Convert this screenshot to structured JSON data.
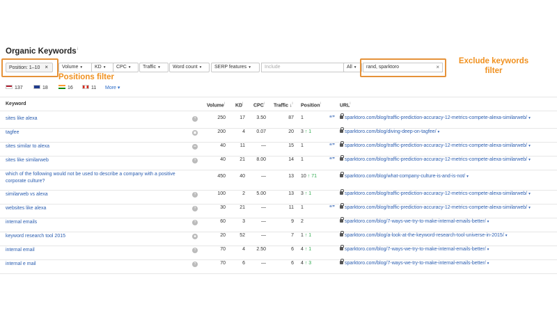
{
  "title": "Organic Keywords",
  "title_info": "i",
  "filters": {
    "position": "Position: 1–10",
    "position_clear": "×",
    "volume": "Volume",
    "kd": "KD",
    "cpc": "CPC",
    "traffic": "Traffic",
    "word_count": "Word count",
    "serp_features": "SERP features",
    "include_placeholder": "Include",
    "all": "All",
    "exclude_value": "rand, sparktoro",
    "exclude_clear": "×",
    "caret": "▾"
  },
  "callouts": {
    "positions": "Positions filter",
    "exclude": "Exclude keywords filter"
  },
  "countries": [
    {
      "code": "us",
      "count": "137"
    },
    {
      "code": "uk",
      "count": "18"
    },
    {
      "code": "in",
      "count": "16"
    },
    {
      "code": "ca",
      "count": "11"
    }
  ],
  "more": "More ▾",
  "columns": {
    "keyword": "Keyword",
    "volume": "Volume",
    "kd": "KD",
    "cpc": "CPC",
    "traffic": "Traffic ↓",
    "position": "Position",
    "url": "URL"
  },
  "rows": [
    {
      "keyword": "sites like alexa",
      "volume": "250",
      "kd": "17",
      "cpc": "3.50",
      "traffic": "87",
      "position": "1",
      "change": "",
      "serp": "?",
      "quote": "“”",
      "url": "sparktoro.com/blog/traffic-prediction-accuracy-12-metrics-compete-alexa-similarweb/"
    },
    {
      "keyword": "tagfee",
      "volume": "200",
      "kd": "4",
      "cpc": "0.07",
      "traffic": "20",
      "position": "3",
      "change": "↑ 1",
      "serp": "▣",
      "quote": "",
      "url": "sparktoro.com/blog/diving-deep-on-tagfee/"
    },
    {
      "keyword": "sites similar to alexa",
      "volume": "40",
      "kd": "11",
      "cpc": "—",
      "traffic": "15",
      "position": "1",
      "change": "",
      "serp": "••",
      "quote": "“”",
      "url": "sparktoro.com/blog/traffic-prediction-accuracy-12-metrics-compete-alexa-similarweb/"
    },
    {
      "keyword": "sites like similarweb",
      "volume": "40",
      "kd": "21",
      "cpc": "8.00",
      "traffic": "14",
      "position": "1",
      "change": "",
      "serp": "?",
      "quote": "“”",
      "url": "sparktoro.com/blog/traffic-prediction-accuracy-12-metrics-compete-alexa-similarweb/"
    },
    {
      "keyword": "which of the following would not be used to describe a company with a positive corporate culture?",
      "volume": "450",
      "kd": "40",
      "cpc": "—",
      "traffic": "13",
      "position": "10",
      "change": "↑ 71",
      "serp": "",
      "quote": "",
      "url": "sparktoro.com/blog/what-company-culture-is-and-is-not/"
    },
    {
      "keyword": "similarweb vs alexa",
      "volume": "100",
      "kd": "2",
      "cpc": "5.00",
      "traffic": "13",
      "position": "3",
      "change": "↑ 1",
      "serp": "?",
      "quote": "",
      "url": "sparktoro.com/blog/traffic-prediction-accuracy-12-metrics-compete-alexa-similarweb/"
    },
    {
      "keyword": "websites like alexa",
      "volume": "30",
      "kd": "21",
      "cpc": "—",
      "traffic": "11",
      "position": "1",
      "change": "",
      "serp": "?",
      "quote": "“”",
      "url": "sparktoro.com/blog/traffic-prediction-accuracy-12-metrics-compete-alexa-similarweb/"
    },
    {
      "keyword": "internal emails",
      "volume": "60",
      "kd": "3",
      "cpc": "—",
      "traffic": "9",
      "position": "2",
      "change": "",
      "serp": "?",
      "quote": "",
      "url": "sparktoro.com/blog/7-ways-we-try-to-make-internal-emails-better/"
    },
    {
      "keyword": "keyword research tool 2015",
      "volume": "20",
      "kd": "52",
      "cpc": "—",
      "traffic": "7",
      "position": "1",
      "change": "↑ 1",
      "serp": "■",
      "quote": "",
      "url": "sparktoro.com/blog/a-look-at-the-keyword-research-tool-universe-in-2015/"
    },
    {
      "keyword": "internal email",
      "volume": "70",
      "kd": "4",
      "cpc": "2.50",
      "traffic": "6",
      "position": "4",
      "change": "↑ 1",
      "serp": "?",
      "quote": "",
      "url": "sparktoro.com/blog/7-ways-we-try-to-make-internal-emails-better/"
    },
    {
      "keyword": "internal e mail",
      "volume": "70",
      "kd": "6",
      "cpc": "—",
      "traffic": "6",
      "position": "4",
      "change": "↑ 3",
      "serp": "?",
      "quote": "",
      "url": "sparktoro.com/blog/7-ways-we-try-to-make-internal-emails-better/"
    }
  ]
}
